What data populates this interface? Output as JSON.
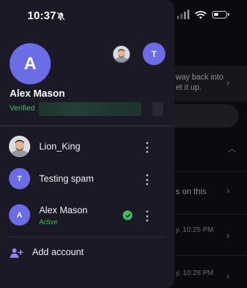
{
  "status_bar": {
    "time": "10:37"
  },
  "background": {
    "snippet_1_line1": "way back into",
    "snippet_1_line2": "et it up.",
    "snippet_2": "s on this",
    "timestamp_1": "y, 10:25 PM",
    "timestamp_2": "y, 10:28 PM"
  },
  "profile": {
    "initial": "A",
    "name": "Alex Mason",
    "verified_label": "Verified",
    "other_account_initial": "T"
  },
  "accounts": [
    {
      "name": "Lion_King",
      "type": "photo"
    },
    {
      "name": "Testing spam",
      "initial": "T",
      "type": "initial"
    },
    {
      "name": "Alex Mason",
      "initial": "A",
      "type": "initial",
      "status": "Active"
    }
  ],
  "add_account_label": "Add account",
  "colors": {
    "accent": "#6b6de6",
    "verified": "#3fbf5a",
    "drawer_bg": "#1b1926"
  }
}
